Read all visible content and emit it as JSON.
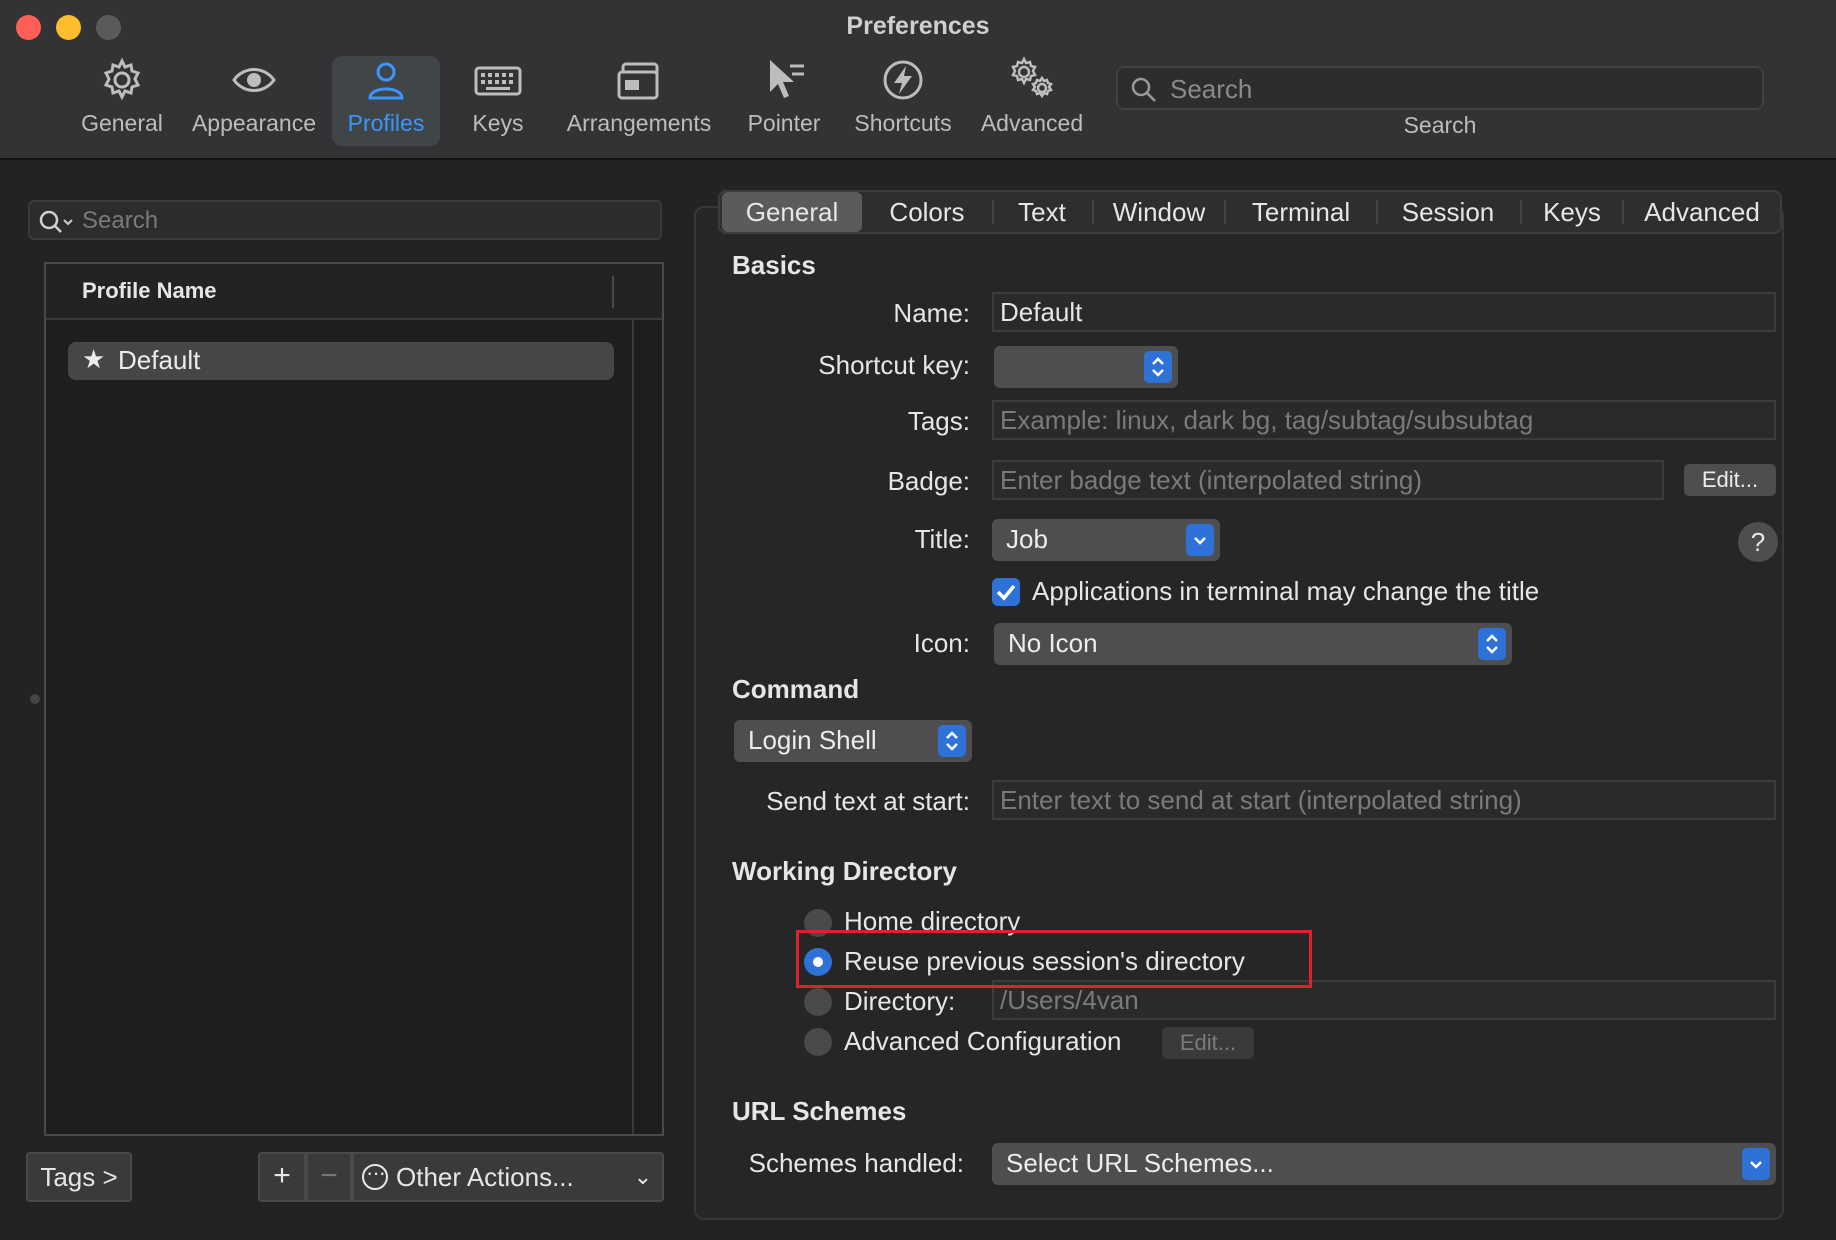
{
  "window": {
    "title": "Preferences",
    "toolbar": [
      {
        "id": "general",
        "label": "General",
        "icon": "gear-icon"
      },
      {
        "id": "appearance",
        "label": "Appearance",
        "icon": "eye-icon"
      },
      {
        "id": "profiles",
        "label": "Profiles",
        "icon": "person-icon",
        "selected": true
      },
      {
        "id": "keys",
        "label": "Keys",
        "icon": "keyboard-icon"
      },
      {
        "id": "arrangements",
        "label": "Arrangements",
        "icon": "windows-icon"
      },
      {
        "id": "pointer",
        "label": "Pointer",
        "icon": "pointer-icon"
      },
      {
        "id": "shortcuts",
        "label": "Shortcuts",
        "icon": "bolt-icon"
      },
      {
        "id": "advanced",
        "label": "Advanced",
        "icon": "gears-icon"
      }
    ],
    "search": {
      "placeholder": "Search",
      "label": "Search"
    }
  },
  "profiles_list": {
    "search_placeholder": "Search",
    "column_header": "Profile Name",
    "items": [
      {
        "name": "Default",
        "default": true,
        "selected": true
      }
    ],
    "tags_button": "Tags >",
    "add_button": "+",
    "remove_button": "−",
    "other_actions": "Other Actions..."
  },
  "tabs": [
    "General",
    "Colors",
    "Text",
    "Window",
    "Terminal",
    "Session",
    "Keys",
    "Advanced"
  ],
  "active_tab": "General",
  "basics": {
    "title": "Basics",
    "name_label": "Name:",
    "name_value": "Default",
    "shortcut_label": "Shortcut key:",
    "shortcut_value": "",
    "tags_label": "Tags:",
    "tags_placeholder": "Example: linux, dark bg, tag/subtag/subsubtag",
    "badge_label": "Badge:",
    "badge_placeholder": "Enter badge text (interpolated string)",
    "badge_edit": "Edit...",
    "title_label": "Title:",
    "title_value": "Job",
    "help": "?",
    "apps_change_title": "Applications in terminal may change the title",
    "icon_label": "Icon:",
    "icon_value": "No Icon"
  },
  "command": {
    "title": "Command",
    "shell_value": "Login Shell",
    "send_text_label": "Send text at start:",
    "send_text_placeholder": "Enter text to send at start (interpolated string)"
  },
  "working_directory": {
    "title": "Working Directory",
    "options": {
      "home": "Home directory",
      "reuse": "Reuse previous session's directory",
      "directory": "Directory:",
      "advanced": "Advanced Configuration"
    },
    "selected": "reuse",
    "directory_placeholder": "/Users/4van",
    "advanced_edit": "Edit..."
  },
  "url_schemes": {
    "title": "URL Schemes",
    "handled_label": "Schemes handled:",
    "handled_value": "Select URL Schemes..."
  },
  "colors": {
    "accent": "#2e72d8",
    "selected_toolbar": "#3b95ff",
    "highlight": "#e0202a"
  }
}
